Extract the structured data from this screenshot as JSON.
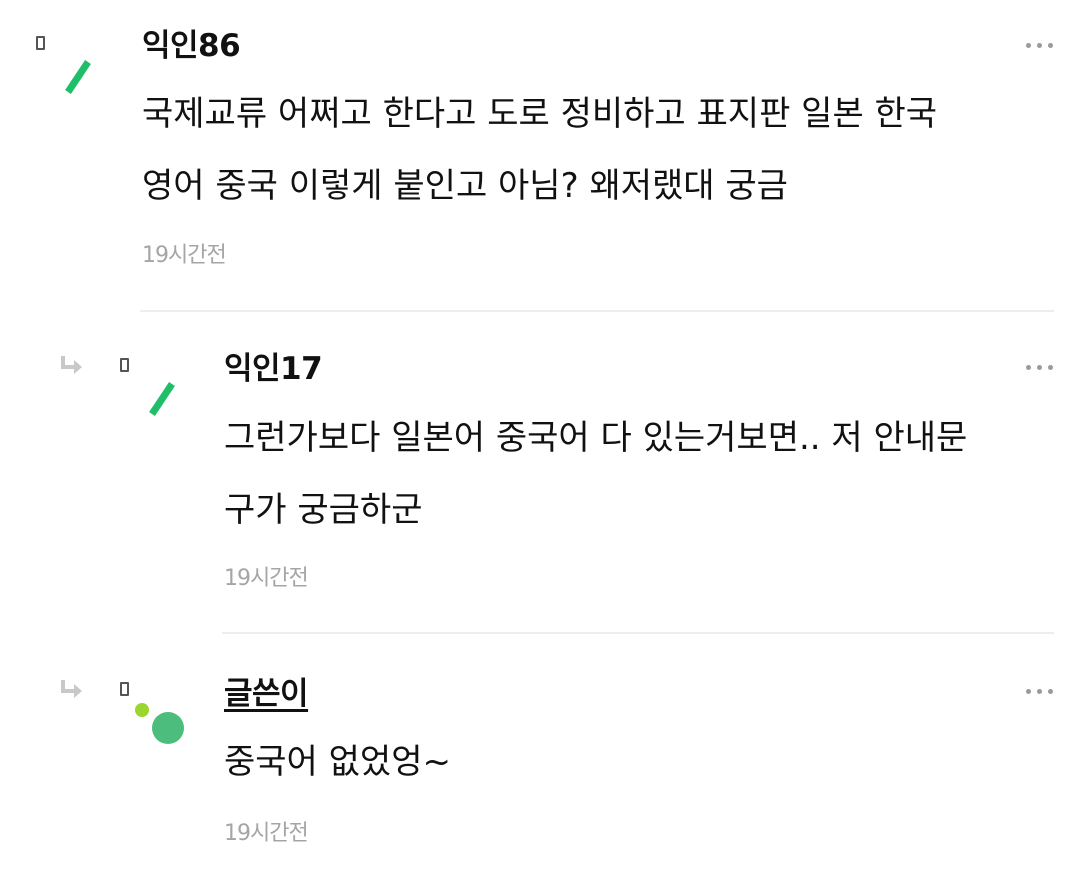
{
  "comments": [
    {
      "username": "익인86",
      "text": "국제교류 어쩌고 한다고 도로 정비하고 표지판 일본 한국\n영어 중국 이렇게 붙인고 아님? 왜저랬대 궁금",
      "time": "19시간전",
      "avatar_color": "#1fbf6a"
    },
    {
      "username": "익인17",
      "text": "그런가보다 일본어 중국어 다 있는거보면.. 저 안내문\n구가 궁금하군",
      "time": "19시간전",
      "avatar_color": "#1fbf6a"
    },
    {
      "username": "글쓴이",
      "text": "중국어 없었엉~",
      "time": "19시간전",
      "avatar_colors": [
        "#9bd62f",
        "#4cbd7c"
      ]
    }
  ],
  "icons": {
    "reply": "reply-arrow-icon",
    "more": "more-options-icon",
    "box": "square-marker-icon"
  },
  "colors": {
    "accent_green": "#1fbf6a",
    "time_gray": "#a5a5a5",
    "divider": "#eeeeee"
  }
}
